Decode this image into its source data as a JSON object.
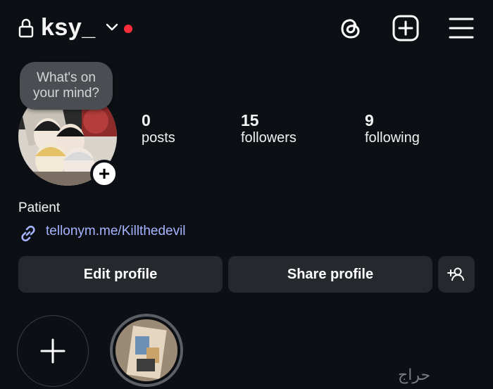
{
  "header": {
    "username": "ksy_",
    "icons": [
      "lock-icon",
      "chevron-down-icon",
      "threads-icon",
      "create-plus-icon",
      "menu-icon"
    ],
    "notification_color": "#ff2d3c"
  },
  "note": {
    "text": "What's on your mind?"
  },
  "stats": [
    {
      "count": "0",
      "label": "posts"
    },
    {
      "count": "15",
      "label": "followers"
    },
    {
      "count": "9",
      "label": "following"
    }
  ],
  "bio": {
    "name": "Patient",
    "link": "tellonym.me/Killthedevil",
    "link_color": "#a6b3ff"
  },
  "buttons": {
    "edit": "Edit profile",
    "share": "Share profile"
  },
  "watermark": "حراج"
}
